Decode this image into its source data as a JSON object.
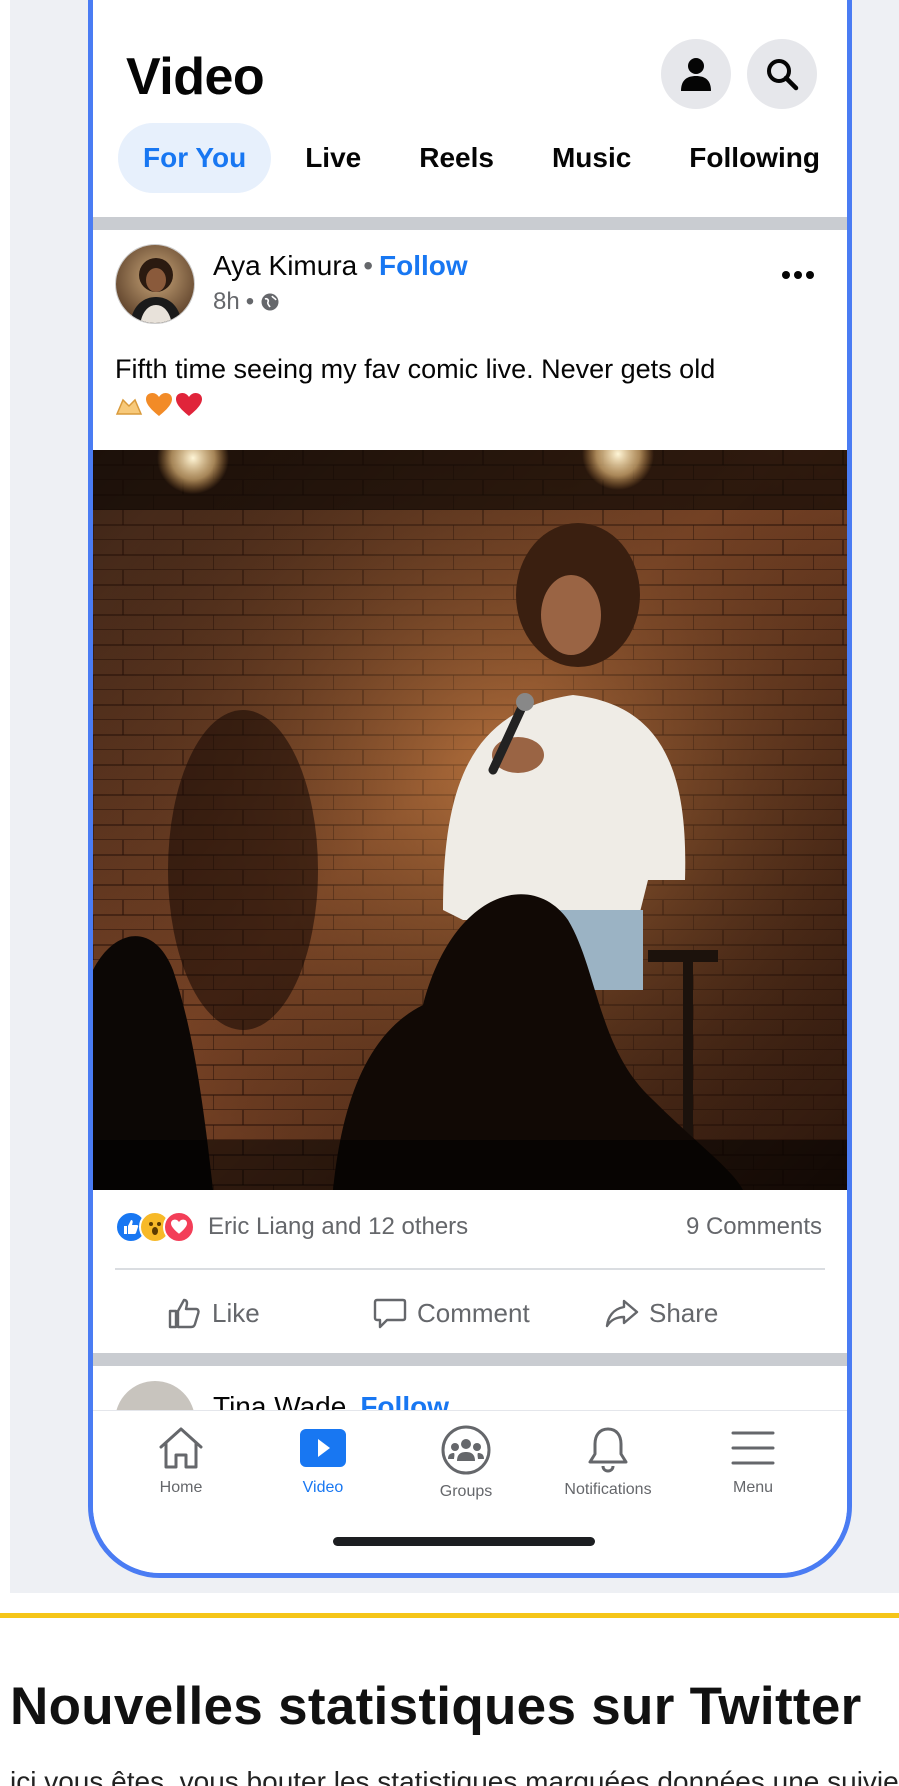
{
  "header": {
    "title": "Video",
    "profile_icon": "person-icon",
    "search_icon": "search-icon"
  },
  "tabs": [
    {
      "label": "For You",
      "active": true
    },
    {
      "label": "Live",
      "active": false
    },
    {
      "label": "Reels",
      "active": false
    },
    {
      "label": "Music",
      "active": false
    },
    {
      "label": "Following",
      "active": false
    }
  ],
  "post": {
    "author": "Aya Kimura",
    "separator": "•",
    "follow_label": "Follow",
    "time": "8h",
    "meta_separator": "•",
    "audience_icon": "globe-icon",
    "more_icon": "more-options-icon",
    "caption": "Fifth time seeing my fav comic live. Never gets old",
    "caption_emojis": [
      "hands-icon",
      "orange-heart-icon",
      "red-heart-icon"
    ],
    "reactions": {
      "icons": [
        "like-reaction-icon",
        "wow-reaction-icon",
        "love-reaction-icon"
      ],
      "summary": "Eric Liang and 12 others",
      "comments": "9 Comments"
    },
    "actions": {
      "like": "Like",
      "comment": "Comment",
      "share": "Share"
    }
  },
  "next_post": {
    "author": "Tina Wade",
    "follow_label": "Follow"
  },
  "bottom_nav": [
    {
      "label": "Home",
      "icon": "home-icon",
      "active": false
    },
    {
      "label": "Video",
      "icon": "video-icon",
      "active": true
    },
    {
      "label": "Groups",
      "icon": "groups-icon",
      "active": false
    },
    {
      "label": "Notifications",
      "icon": "bell-icon",
      "active": false
    },
    {
      "label": "Menu",
      "icon": "menu-icon",
      "active": false
    }
  ],
  "article": {
    "title": "Nouvelles statistiques sur Twitter",
    "snippet": "ici vous êtes, vous bouter les statistiques marquées données une suivie"
  },
  "colors": {
    "accent": "#1877f2",
    "frame": "#4a7cf3",
    "rule": "#f5c518"
  }
}
